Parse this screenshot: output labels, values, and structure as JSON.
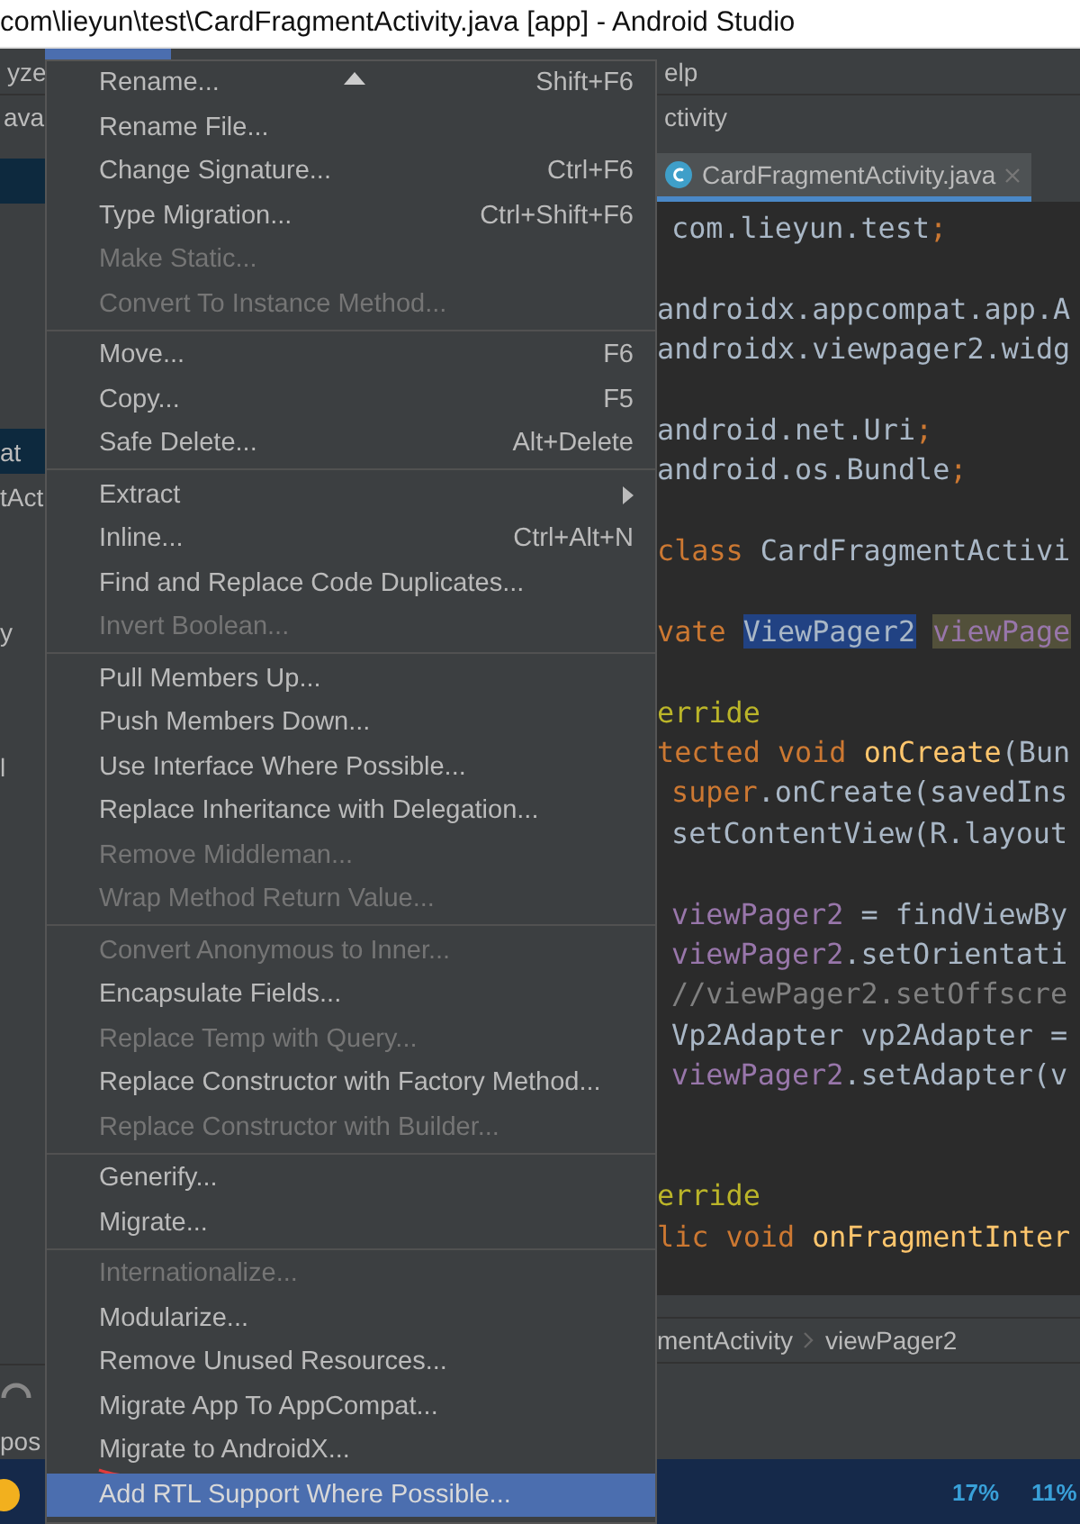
{
  "window": {
    "title": "com\\lieyun\\test\\CardFragmentActivity.java [app] - Android Studio"
  },
  "menubar": [
    {
      "label": "yze",
      "selected": false
    },
    {
      "selected": true
    },
    {
      "label": "elp",
      "selected": false
    }
  ],
  "navbar": {
    "left": "ava",
    "right": "ctivity"
  },
  "sidebar": {
    "items": [
      {
        "selected": true
      },
      {
        "selected": false
      },
      {
        "selected": false
      },
      {
        "selected": false
      },
      {
        "selected": false
      },
      {
        "selected": false
      },
      {
        "label": "at",
        "selected": true
      },
      {
        "label": "tAct",
        "selected": false
      },
      {
        "selected": false
      },
      {
        "selected": false
      },
      {
        "label": "y",
        "selected": false
      },
      {
        "selected": false
      },
      {
        "selected": false
      },
      {
        "label": "l",
        "selected": false
      }
    ],
    "bottom_label": "pos"
  },
  "menu": {
    "items": [
      {
        "kind": "action",
        "label": "Rename...",
        "shortcut": "Shift+F6",
        "disabled": false,
        "selected": false,
        "annotated": false
      },
      {
        "kind": "action",
        "label": "Rename File...",
        "disabled": false,
        "selected": false,
        "annotated": false
      },
      {
        "kind": "action",
        "label": "Change Signature...",
        "shortcut": "Ctrl+F6",
        "disabled": false,
        "selected": false,
        "annotated": false
      },
      {
        "kind": "action",
        "label": "Type Migration...",
        "shortcut": "Ctrl+Shift+F6",
        "disabled": false,
        "selected": false,
        "annotated": false
      },
      {
        "kind": "action",
        "label": "Make Static...",
        "disabled": true,
        "selected": false,
        "annotated": false
      },
      {
        "kind": "action",
        "label": "Convert To Instance Method...",
        "disabled": true,
        "selected": false,
        "annotated": false
      },
      {
        "kind": "separator"
      },
      {
        "kind": "action",
        "label": "Move...",
        "shortcut": "F6",
        "disabled": false,
        "selected": false,
        "annotated": false
      },
      {
        "kind": "action",
        "label": "Copy...",
        "shortcut": "F5",
        "disabled": false,
        "selected": false,
        "annotated": false
      },
      {
        "kind": "action",
        "label": "Safe Delete...",
        "shortcut": "Alt+Delete",
        "disabled": false,
        "selected": false,
        "annotated": false
      },
      {
        "kind": "separator"
      },
      {
        "kind": "submenu",
        "label": "Extract",
        "disabled": false,
        "selected": false,
        "annotated": false
      },
      {
        "kind": "action",
        "label": "Inline...",
        "shortcut": "Ctrl+Alt+N",
        "disabled": false,
        "selected": false,
        "annotated": false
      },
      {
        "kind": "action",
        "label": "Find and Replace Code Duplicates...",
        "disabled": false,
        "selected": false,
        "annotated": false
      },
      {
        "kind": "action",
        "label": "Invert Boolean...",
        "disabled": true,
        "selected": false,
        "annotated": false
      },
      {
        "kind": "separator"
      },
      {
        "kind": "action",
        "label": "Pull Members Up...",
        "disabled": false,
        "selected": false,
        "annotated": false
      },
      {
        "kind": "action",
        "label": "Push Members Down...",
        "disabled": false,
        "selected": false,
        "annotated": false
      },
      {
        "kind": "action",
        "label": "Use Interface Where Possible...",
        "disabled": false,
        "selected": false,
        "annotated": false
      },
      {
        "kind": "action",
        "label": "Replace Inheritance with Delegation...",
        "disabled": false,
        "selected": false,
        "annotated": false
      },
      {
        "kind": "action",
        "label": "Remove Middleman...",
        "disabled": true,
        "selected": false,
        "annotated": false
      },
      {
        "kind": "action",
        "label": "Wrap Method Return Value...",
        "disabled": true,
        "selected": false,
        "annotated": false
      },
      {
        "kind": "separator"
      },
      {
        "kind": "action",
        "label": "Convert Anonymous to Inner...",
        "disabled": true,
        "selected": false,
        "annotated": false
      },
      {
        "kind": "action",
        "label": "Encapsulate Fields...",
        "disabled": false,
        "selected": false,
        "annotated": false
      },
      {
        "kind": "action",
        "label": "Replace Temp with Query...",
        "disabled": true,
        "selected": false,
        "annotated": false
      },
      {
        "kind": "action",
        "label": "Replace Constructor with Factory Method...",
        "disabled": false,
        "selected": false,
        "annotated": false
      },
      {
        "kind": "action",
        "label": "Replace Constructor with Builder...",
        "disabled": true,
        "selected": false,
        "annotated": false
      },
      {
        "kind": "separator"
      },
      {
        "kind": "action",
        "label": "Generify...",
        "disabled": false,
        "selected": false,
        "annotated": false
      },
      {
        "kind": "action",
        "label": "Migrate...",
        "disabled": false,
        "selected": false,
        "annotated": false
      },
      {
        "kind": "separator"
      },
      {
        "kind": "action",
        "label": "Internationalize...",
        "disabled": true,
        "selected": false,
        "annotated": false
      },
      {
        "kind": "action",
        "label": "Modularize...",
        "disabled": false,
        "selected": false,
        "annotated": false
      },
      {
        "kind": "action",
        "label": "Remove Unused Resources...",
        "disabled": false,
        "selected": false,
        "annotated": false
      },
      {
        "kind": "action",
        "label": "Migrate App To AppCompat...",
        "disabled": false,
        "selected": false,
        "annotated": false
      },
      {
        "kind": "action",
        "label": "Migrate to AndroidX...",
        "disabled": false,
        "selected": false,
        "annotated": true
      },
      {
        "kind": "action",
        "label": "Add RTL Support Where Possible...",
        "disabled": false,
        "selected": true,
        "annotated": false
      }
    ]
  },
  "editor": {
    "tab": {
      "label": "CardFragmentActivity.java",
      "selected": true
    },
    "lines": [
      {
        "kind": "code",
        "indented": true,
        "tokens": [
          {
            "text": "com.lieyun.test",
            "kind": "plain"
          },
          {
            "text": ";",
            "kind": "keyword"
          }
        ]
      },
      {
        "kind": "blank"
      },
      {
        "kind": "code",
        "indented": false,
        "tokens": [
          {
            "text": "androidx.appcompat.app.A",
            "kind": "plain"
          }
        ]
      },
      {
        "kind": "code",
        "indented": false,
        "tokens": [
          {
            "text": "androidx.viewpager2.widg",
            "kind": "plain"
          }
        ]
      },
      {
        "kind": "blank"
      },
      {
        "kind": "code",
        "indented": false,
        "tokens": [
          {
            "text": "android.net.Uri",
            "kind": "plain"
          },
          {
            "text": ";",
            "kind": "keyword"
          }
        ]
      },
      {
        "kind": "code",
        "indented": false,
        "tokens": [
          {
            "text": "android.os.Bundle",
            "kind": "plain"
          },
          {
            "text": ";",
            "kind": "keyword"
          }
        ]
      },
      {
        "kind": "blank"
      },
      {
        "kind": "code",
        "indented": false,
        "tokens": [
          {
            "text": "class ",
            "kind": "keyword"
          },
          {
            "text": "CardFragmentActivi",
            "kind": "plain"
          }
        ]
      },
      {
        "kind": "blank"
      },
      {
        "kind": "code",
        "indented": false,
        "tokens": [
          {
            "text": "vate ",
            "kind": "keyword"
          },
          {
            "text": "ViewPager2",
            "kind": "selection"
          },
          {
            "text": "viewPage",
            "kind": "usage"
          }
        ]
      },
      {
        "kind": "blank"
      },
      {
        "kind": "code",
        "indented": false,
        "tokens": [
          {
            "text": "erride",
            "kind": "annotation"
          }
        ]
      },
      {
        "kind": "code",
        "indented": false,
        "tokens": [
          {
            "text": "tected void ",
            "kind": "keyword"
          },
          {
            "text": "onCreate",
            "kind": "method"
          },
          {
            "text": "(Bun",
            "kind": "plain"
          }
        ]
      },
      {
        "kind": "code",
        "indented": true,
        "tokens": [
          {
            "text": "super",
            "kind": "keyword"
          },
          {
            "text": ".onCreate(savedIns",
            "kind": "plain"
          }
        ]
      },
      {
        "kind": "code",
        "indented": true,
        "tokens": [
          {
            "text": "setContentView(R.layout",
            "kind": "plain"
          }
        ]
      },
      {
        "kind": "blank"
      },
      {
        "kind": "code",
        "indented": true,
        "tokens": [
          {
            "text": "viewPager2",
            "kind": "field"
          },
          {
            "text": " = findViewBy",
            "kind": "plain"
          }
        ]
      },
      {
        "kind": "code",
        "indented": true,
        "tokens": [
          {
            "text": "viewPager2",
            "kind": "field"
          },
          {
            "text": ".setOrientati",
            "kind": "plain"
          }
        ]
      },
      {
        "kind": "code",
        "indented": true,
        "tokens": [
          {
            "text": "//viewPager2.setOffscre",
            "kind": "comment"
          }
        ]
      },
      {
        "kind": "code",
        "indented": true,
        "tokens": [
          {
            "text": "Vp2Adapter vp2Adapter =",
            "kind": "plain"
          }
        ]
      },
      {
        "kind": "code",
        "indented": true,
        "tokens": [
          {
            "text": "viewPager2",
            "kind": "field"
          },
          {
            "text": ".setAdapter(v",
            "kind": "plain"
          }
        ]
      },
      {
        "kind": "blank"
      },
      {
        "kind": "blank"
      },
      {
        "kind": "code",
        "indented": false,
        "tokens": [
          {
            "text": "erride",
            "kind": "annotation"
          }
        ]
      },
      {
        "kind": "code",
        "indented": false,
        "tokens": [
          {
            "text": "lic void ",
            "kind": "keyword"
          },
          {
            "text": "onFragmentInter",
            "kind": "method"
          }
        ]
      }
    ],
    "breadcrumbs": [
      "mentActivity",
      "viewPager2"
    ]
  },
  "taskbar": {
    "readings": [
      "17%",
      "11%"
    ]
  }
}
